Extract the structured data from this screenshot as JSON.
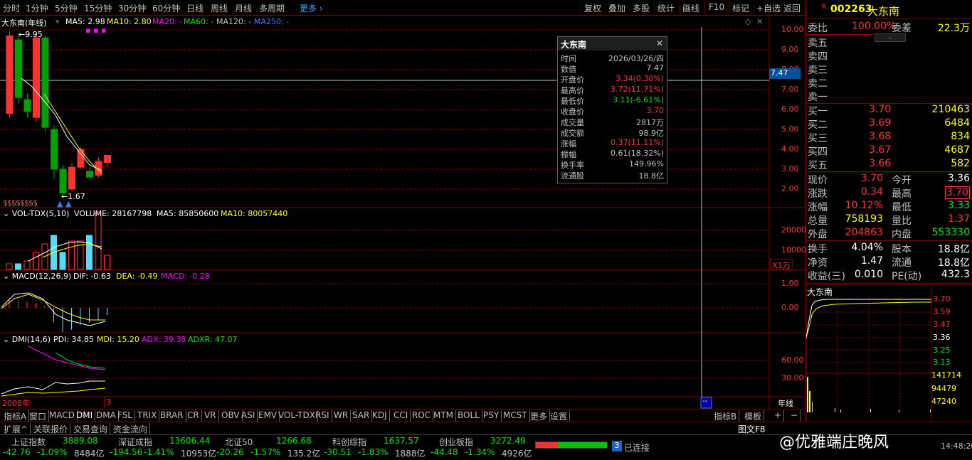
{
  "toolbar": {
    "periods": [
      "分时",
      "1分钟",
      "5分钟",
      "15分钟",
      "30分钟",
      "60分钟",
      "日线",
      "周线",
      "月线",
      "多周期",
      "更多"
    ],
    "right_items": [
      "复权",
      "叠加",
      "多股",
      "统计",
      "画线",
      "F10",
      "标记",
      "+自选",
      "返回"
    ]
  },
  "kline": {
    "name": "大东南",
    "period": "(年线)",
    "ma5": "MA5: 2.98",
    "ma10": "MA10: 2.80",
    "ma20": "MA20: -",
    "ma60": "MA60: -",
    "ma120": "MA120: -",
    "ma250": "MA250: -",
    "high_label": "9.95",
    "low_label": "1.67",
    "axis": [
      "10.00",
      "9.00",
      "8.00",
      "7.00",
      "6.00",
      "5.00",
      "4.00",
      "3.00",
      "2.00"
    ],
    "cursor_price": "7.47",
    "candles": [
      {
        "o": 5.8,
        "c": 9.7,
        "h": 9.95,
        "l": 5.6
      },
      {
        "o": 9.5,
        "c": 6.6,
        "h": 9.8,
        "l": 6.3
      },
      {
        "o": 6.5,
        "c": 5.9,
        "h": 6.8,
        "l": 5.6
      },
      {
        "o": 5.6,
        "c": 9.6,
        "h": 9.7,
        "l": 5.4
      },
      {
        "o": 9.6,
        "c": 5.1,
        "h": 9.7,
        "l": 4.9
      },
      {
        "o": 5.0,
        "c": 3.0,
        "h": 5.2,
        "l": 2.5
      },
      {
        "o": 3.0,
        "c": 1.8,
        "h": 3.2,
        "l": 1.67
      },
      {
        "o": 2.0,
        "c": 3.1,
        "h": 3.3,
        "l": 1.9
      },
      {
        "o": 3.1,
        "c": 4.0,
        "h": 4.1,
        "l": 3.0
      },
      {
        "o": 2.9,
        "c": 2.6,
        "h": 3.1,
        "l": 2.5
      },
      {
        "o": 2.7,
        "c": 3.4,
        "h": 3.6,
        "l": 2.6
      },
      {
        "o": 3.34,
        "c": 3.7,
        "h": 3.72,
        "l": 3.11
      }
    ],
    "dividend_marks": "$$$$$$$$"
  },
  "vol": {
    "title": "VOL-TDX(5,10)",
    "volume": "VOLUME: 28167798",
    "ma5": "MA5: 85850600",
    "ma10": "MA10: 80057440",
    "axis": [
      "20000",
      "10000"
    ],
    "unit": "X1万",
    "bars": [
      {
        "v": 0.1,
        "up": true
      },
      {
        "v": 0.1,
        "up": false
      },
      {
        "v": 0.15,
        "up": true
      },
      {
        "v": 0.3,
        "up": true
      },
      {
        "v": 0.45,
        "up": true
      },
      {
        "v": 0.6,
        "up": false
      },
      {
        "v": 0.3,
        "up": false
      },
      {
        "v": 0.5,
        "up": true
      },
      {
        "v": 0.5,
        "up": true
      },
      {
        "v": 0.6,
        "up": false
      },
      {
        "v": 1.0,
        "up": true
      },
      {
        "v": 0.25,
        "up": true
      }
    ]
  },
  "macd": {
    "title": "MACD(12,26,9)",
    "dif": "DIF: -0.63",
    "dea": "DEA: -0.49",
    "macd": "MACD: -0.28",
    "axis": [
      "1.00",
      "0.00"
    ],
    "hist": [
      0.4,
      0.3,
      0.25,
      0.2,
      0.1,
      -0.6,
      -1.0,
      -0.9,
      -0.7,
      -0.6,
      -0.5,
      -0.3
    ]
  },
  "dmi": {
    "title": "DMI(14,6)",
    "pdi": "PDI: 34.85",
    "mdi": "MDI: 15.20",
    "adx": "ADX: 39.38",
    "adxr": "ADXR: 47.07",
    "axis": [
      "60.00",
      "30.00"
    ]
  },
  "xaxis": {
    "start": "2008年",
    "mark": "3",
    "right": "年线",
    "cursor": "--"
  },
  "tooltip": {
    "title": "大东南",
    "rows": [
      {
        "k": "时间",
        "v": "2026/03/26/四",
        "c": "gray"
      },
      {
        "k": "数值",
        "v": "7.47",
        "c": "gray"
      },
      {
        "k": "开盘价",
        "v": "3.34(0.30%)",
        "c": "red"
      },
      {
        "k": "最高价",
        "v": "3.72(11.71%)",
        "c": "red"
      },
      {
        "k": "最低价",
        "v": "3.11(-6.61%)",
        "c": "green"
      },
      {
        "k": "收盘价",
        "v": "3.70",
        "c": "red"
      },
      {
        "k": "成交量",
        "v": "2817万",
        "c": "gray"
      },
      {
        "k": "成交额",
        "v": "98.9亿",
        "c": "gray"
      },
      {
        "k": "涨幅",
        "v": "0.37(11.11%)",
        "c": "red"
      },
      {
        "k": "振幅",
        "v": "0.61(18.32%)",
        "c": "gray"
      },
      {
        "k": "换手率",
        "v": "149.96%",
        "c": "gray"
      },
      {
        "k": "流通股",
        "v": "18.8亿",
        "c": "gray"
      }
    ]
  },
  "quote": {
    "badge": "R",
    "code": "002263",
    "name": "大东南",
    "weibi_k": "委比",
    "weibi_v": "100.00%",
    "weicha_k": "委差",
    "weicha_v": "22.3万",
    "sell": [
      "卖五",
      "卖四",
      "卖三",
      "卖二",
      "卖一"
    ],
    "buy": [
      {
        "k": "买一",
        "p": "3.70",
        "v": "210463"
      },
      {
        "k": "买二",
        "p": "3.69",
        "v": "6484"
      },
      {
        "k": "买三",
        "p": "3.68",
        "v": "834"
      },
      {
        "k": "买四",
        "p": "3.67",
        "v": "4687"
      },
      {
        "k": "买五",
        "p": "3.66",
        "v": "582"
      }
    ],
    "stats": [
      {
        "k1": "现价",
        "v1": "3.70",
        "c1": "red",
        "k2": "今开",
        "v2": "3.36",
        "c2": "white"
      },
      {
        "k1": "涨跌",
        "v1": "0.34",
        "c1": "red",
        "k2": "最高",
        "v2": "3.70",
        "c2": "red"
      },
      {
        "k1": "涨幅",
        "v1": "10.12%",
        "c1": "red",
        "k2": "最低",
        "v2": "3.33",
        "c2": "green"
      },
      {
        "k1": "总量",
        "v1": "758193",
        "c1": "yellow",
        "k2": "量比",
        "v2": "1.37",
        "c2": "red"
      },
      {
        "k1": "外盘",
        "v1": "204863",
        "c1": "red",
        "k2": "内盘",
        "v2": "553330",
        "c2": "green"
      }
    ],
    "fund": [
      {
        "k1": "换手",
        "v1": "4.04%",
        "k2": "股本",
        "v2": "18.8亿"
      },
      {
        "k1": "净资",
        "v1": "1.47",
        "k2": "流通",
        "v2": "18.8亿"
      },
      {
        "k1": "收益(三)",
        "v1": "0.010",
        "k2": "PE(动)",
        "v2": "432.3"
      }
    ],
    "mini_title": "大东南",
    "mini_axis": [
      "3.70",
      "3.59",
      "3.47",
      "3.36",
      "3.25",
      "3.13"
    ],
    "mini_vol_axis": [
      "141714",
      "94479",
      "47240"
    ]
  },
  "tabs": [
    "指标A",
    "窗口",
    "MACD",
    "DMI",
    "DMA",
    "FSL",
    "TRIX",
    "BRAR",
    "CR",
    "VR",
    "OBV",
    "ASI",
    "EMV",
    "VOL-TDX",
    "RSI",
    "WR",
    "SAR",
    "KDJ",
    "CCI",
    "ROC",
    "MTM",
    "BOLL",
    "PSY",
    "MCST",
    "更多",
    "设置"
  ],
  "tabs_right": [
    "指标B",
    "模板",
    "+",
    "−"
  ],
  "tabs2": [
    "扩展^",
    "关联报价",
    "交易查询",
    "资金流向"
  ],
  "tabs2_right": "图文F8",
  "indices": [
    {
      "name": "上证指数",
      "val": "3889.08",
      "chg": "-42.76",
      "pct": "-1.09%",
      "amt": "8484亿"
    },
    {
      "name": "深证成指",
      "val": "13606.44",
      "chg": "-194.56",
      "pct": "-1.41%",
      "amt": "10953亿"
    },
    {
      "name": "北证50",
      "val": "1266.68",
      "chg": "-20.26",
      "pct": "-1.57%",
      "amt": "135.2亿"
    },
    {
      "name": "科创综指",
      "val": "1637.57",
      "chg": "-30.51",
      "pct": "-1.83%",
      "amt": "1888亿"
    },
    {
      "name": "创业板指",
      "val": "3272.49",
      "chg": "-44.48",
      "pct": "-1.34%",
      "amt": "4926亿"
    }
  ],
  "connection": {
    "badge": "3",
    "text": "已连接"
  },
  "watermark": "@优雅端庄晚风",
  "clock": "14:48:20"
}
